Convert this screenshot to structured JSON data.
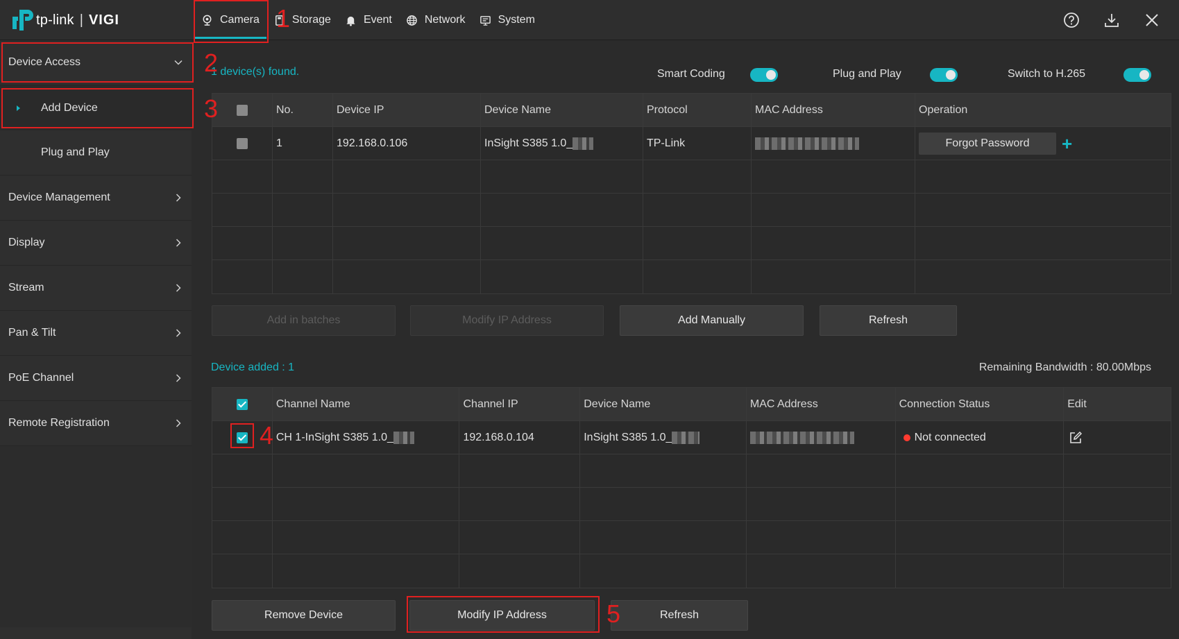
{
  "brand": {
    "name": "tp-link",
    "separator": "|",
    "product": "VIGI"
  },
  "tabs": [
    {
      "label": "Camera",
      "icon": "camera-icon",
      "active": true
    },
    {
      "label": "Storage",
      "icon": "storage-icon"
    },
    {
      "label": "Event",
      "icon": "bell-icon"
    },
    {
      "label": "Network",
      "icon": "globe-icon"
    },
    {
      "label": "System",
      "icon": "monitor-icon"
    }
  ],
  "top_icons": [
    "help-icon",
    "download-icon",
    "close-icon"
  ],
  "sidebar": {
    "device_access": "Device Access",
    "add_device": "Add Device",
    "plug_and_play": "Plug and Play",
    "items": [
      "Device Management",
      "Display",
      "Stream",
      "Pan & Tilt",
      "PoE Channel",
      "Remote Registration"
    ]
  },
  "found_text": "1 device(s) found.",
  "toggles": {
    "smart_coding": "Smart Coding",
    "plug_and_play": "Plug and Play",
    "h265": "Switch to H.265"
  },
  "search_table": {
    "headers": [
      "No.",
      "Device IP",
      "Device Name",
      "Protocol",
      "MAC Address",
      "Operation"
    ],
    "row": {
      "no": "1",
      "ip": "192.168.0.106",
      "name": "InSight S385 1.0_",
      "protocol": "TP-Link",
      "operation": "Forgot Password"
    }
  },
  "buttons_top": {
    "add_batches": "Add in batches",
    "modify_ip": "Modify IP Address",
    "add_manually": "Add Manually",
    "refresh": "Refresh"
  },
  "device_added": "Device added : 1",
  "bandwidth": "Remaining Bandwidth : 80.00Mbps",
  "added_table": {
    "headers": [
      "Channel Name",
      "Channel IP",
      "Device Name",
      "MAC Address",
      "Connection Status",
      "Edit"
    ],
    "row": {
      "channel": "CH 1-InSight S385 1.0_",
      "ip": "192.168.0.104",
      "name": "InSight S385 1.0_",
      "status": "Not connected"
    }
  },
  "buttons_bottom": {
    "remove": "Remove Device",
    "modify_ip": "Modify IP Address",
    "refresh": "Refresh"
  },
  "annotations": [
    "1",
    "2",
    "3",
    "4",
    "5"
  ],
  "colors": {
    "accent": "#17b6c3",
    "annotation": "#e02020",
    "status_error": "#ff3b30"
  }
}
